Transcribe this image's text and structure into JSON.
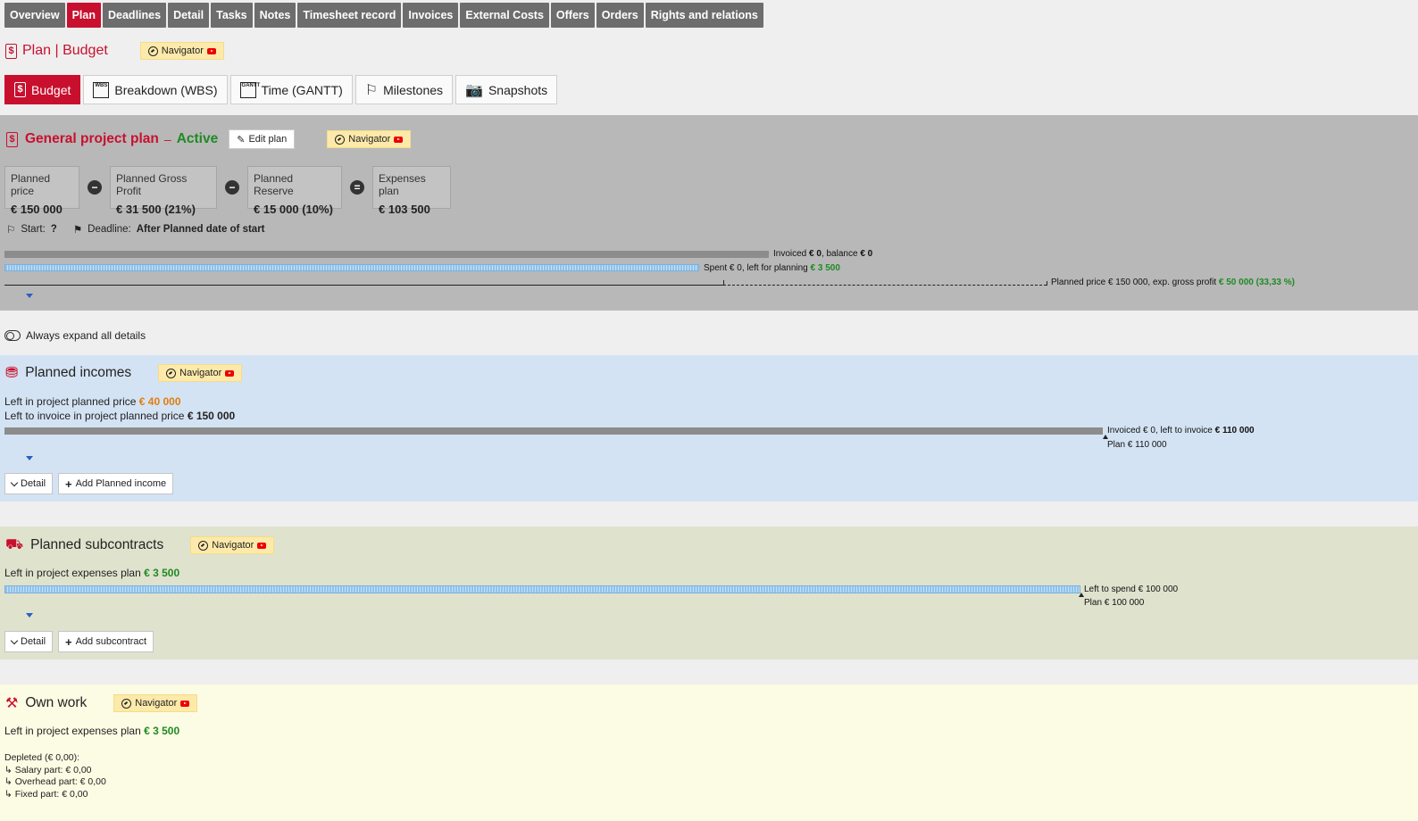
{
  "tabs": [
    "Overview",
    "Plan",
    "Deadlines",
    "Detail",
    "Tasks",
    "Notes",
    "Timesheet record",
    "Invoices",
    "External Costs",
    "Offers",
    "Orders",
    "Rights and relations"
  ],
  "active_tab": "Plan",
  "page_title": "Plan | Budget",
  "navigator_label": "Navigator",
  "subtabs": [
    "Budget",
    "Breakdown (WBS)",
    "Time (GANTT)",
    "Milestones",
    "Snapshots"
  ],
  "plan": {
    "title": "General project plan",
    "dash": "–",
    "status": "Active",
    "edit_label": "Edit plan",
    "cards": [
      {
        "label": "Planned price",
        "value": "€ 150 000"
      },
      {
        "label": "Planned Gross Profit",
        "value": "€ 31 500  (21%)"
      },
      {
        "label": "Planned Reserve",
        "value": "€ 15 000  (10%)"
      },
      {
        "label": "Expenses plan",
        "value": "€ 103 500"
      }
    ],
    "start_label": "Start:",
    "start_value": "?",
    "deadline_label": "Deadline:",
    "deadline_value": "After Planned date of start",
    "invoiced_text": "Invoiced",
    "invoiced_value": "€ 0",
    "balance_text": ", balance",
    "balance_value": "€ 0",
    "spent_text": "Spent € 0, left for planning",
    "spent_left": "€ 3 500",
    "planned_text": "Planned price € 150 000, exp. gross profit",
    "planned_profit": "€ 50 000 (33,33 %)",
    "invoiced_fraction": 0.546,
    "spent_fraction": 0.496
  },
  "expand_label": "Always expand all details",
  "incomes": {
    "title": "Planned incomes",
    "left_price_label": "Left in project planned price",
    "left_price_value": "€ 40 000",
    "left_invoice_label": "Left to invoice in project planned price",
    "left_invoice_value": "€ 150 000",
    "bar_text": "Invoiced € 0, left to invoice",
    "bar_value": "€ 110 000",
    "plan_text": "Plan € 110 000",
    "detail_label": "Detail",
    "add_label": "Add Planned income"
  },
  "subcontracts": {
    "title": "Planned subcontracts",
    "left_label": "Left in project expenses plan",
    "left_value": "€ 3 500",
    "bar_text": "Left to spend € 100 000",
    "plan_text": "Plan € 100 000",
    "detail_label": "Detail",
    "add_label": "Add subcontract"
  },
  "own_work": {
    "title": "Own work",
    "left_label": "Left in project expenses plan",
    "left_value": "€ 3 500",
    "depleted": "Depleted (€ 0,00):",
    "salary": "↳ Salary part: € 0,00",
    "overhead": "↳ Overhead part: € 0,00",
    "fixed": "↳ Fixed part: € 0,00"
  },
  "colors": {
    "accent": "#c8102e",
    "positive": "#1f8a24",
    "warning": "#e07d0d",
    "income_bg": "#d4e3f3",
    "subcontract_bg": "#dfe2cd",
    "own_work_bg": "#fcfbe3"
  }
}
